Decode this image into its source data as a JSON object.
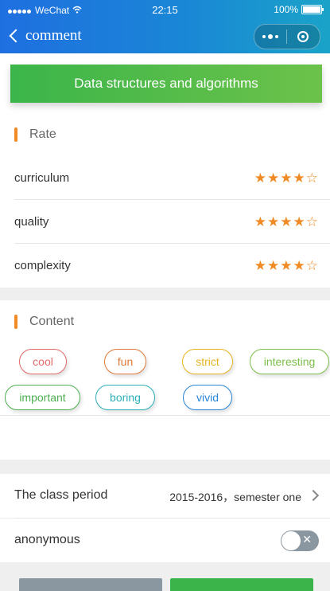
{
  "status_bar": {
    "carrier": "WeChat",
    "time": "22:15",
    "battery": "100%"
  },
  "nav": {
    "title": "comment"
  },
  "course": {
    "name": "Data structures and algorithms"
  },
  "rate": {
    "title": "Rate",
    "items": [
      {
        "label": "curriculum",
        "stars": 4,
        "max": 5
      },
      {
        "label": "quality",
        "stars": 4,
        "max": 5
      },
      {
        "label": "complexity",
        "stars": 4,
        "max": 5
      }
    ]
  },
  "content": {
    "title": "Content",
    "tags": [
      {
        "label": "cool",
        "color": "#e06a6a"
      },
      {
        "label": "fun",
        "color": "#e07a3a"
      },
      {
        "label": "strict",
        "color": "#e6b422"
      },
      {
        "label": "interesting",
        "color": "#7cbf4a"
      },
      {
        "label": "important",
        "color": "#4cb050"
      },
      {
        "label": "boring",
        "color": "#2bb0b8"
      },
      {
        "label": "vivid",
        "color": "#2a86d8"
      }
    ]
  },
  "period": {
    "label": "The class period",
    "value": "2015-2016，semester one"
  },
  "anonymous": {
    "label": "anonymous",
    "on": false
  },
  "colors": {
    "accent": "#f08a24",
    "nav": "#1a86d6",
    "banner": "#3bb54a",
    "cancel": "#8a97a0",
    "submit": "#3bb54a"
  }
}
